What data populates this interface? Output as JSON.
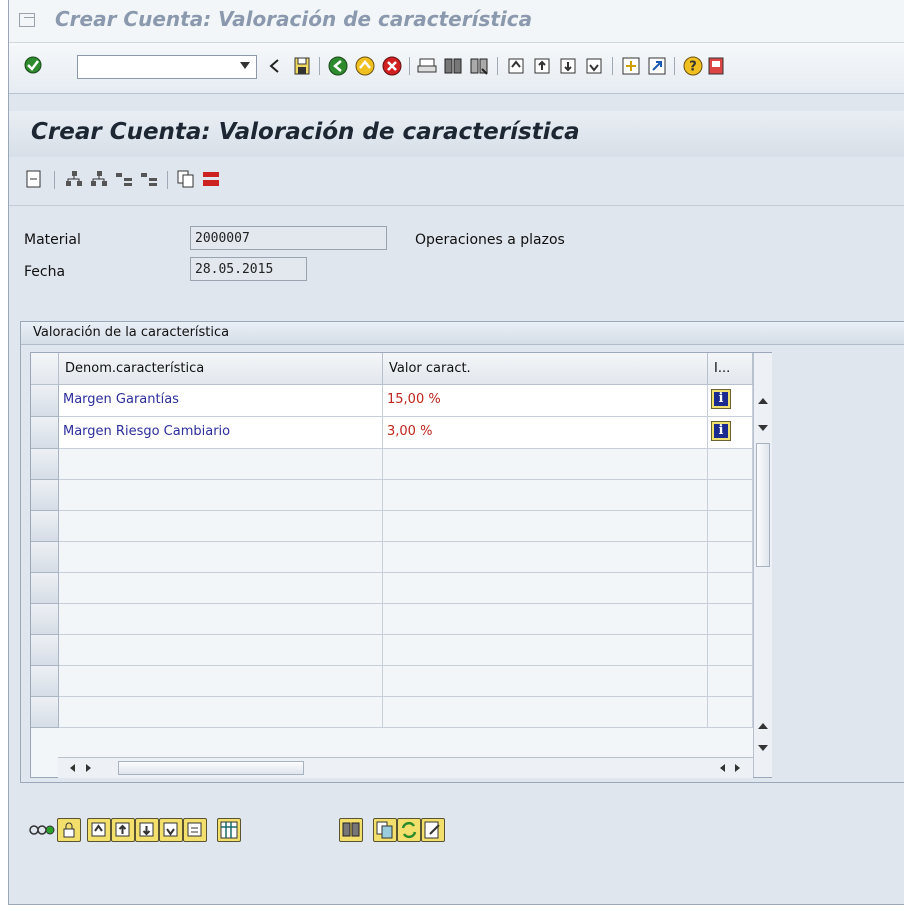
{
  "window": {
    "title": "Crear Cuenta: Valoración de característica"
  },
  "toolbar": {
    "command_field_value": ""
  },
  "app": {
    "title": "Crear Cuenta: Valoración de característica"
  },
  "header": {
    "material_label": "Material",
    "material_value": "2000007",
    "material_desc": "Operaciones a plazos",
    "fecha_label": "Fecha",
    "fecha_value": "28.05.2015"
  },
  "group": {
    "title": "Valoración de la característica"
  },
  "table": {
    "columns": [
      "Denom.característica",
      "Valor caract.",
      "I..."
    ],
    "rows": [
      {
        "name": "Margen Garantías",
        "value": "15,00 %"
      },
      {
        "name": "Margen Riesgo Cambiario",
        "value": "3,00 %"
      }
    ],
    "empty_rows": 10
  },
  "colors": {
    "name_text": "#2b2e9c",
    "value_text": "#c0241b",
    "info_button": "#f0e070"
  }
}
